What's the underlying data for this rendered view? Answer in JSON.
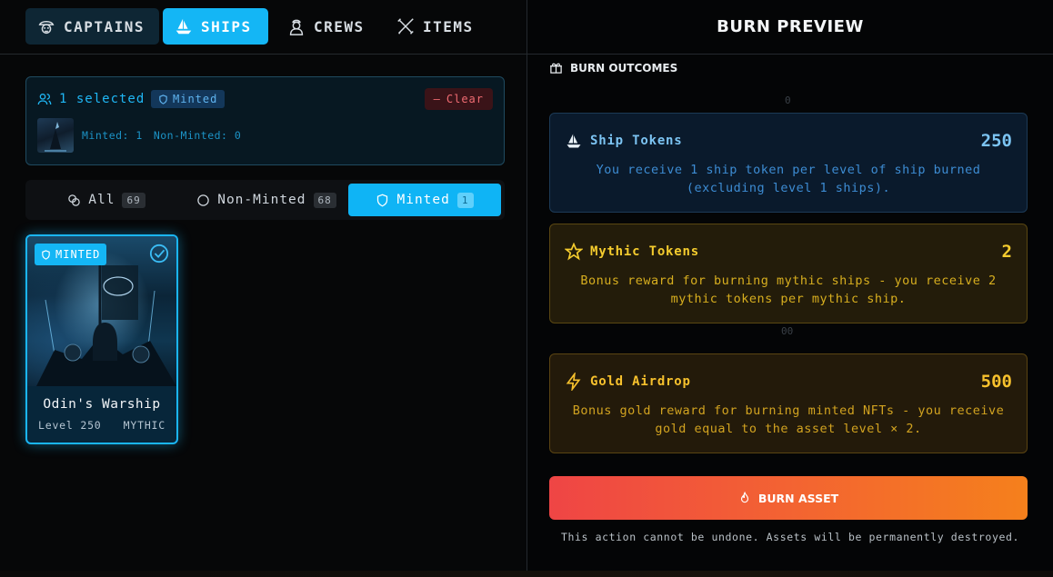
{
  "tabs": [
    {
      "label": "CAPTAINS",
      "icon": "pirate-icon"
    },
    {
      "label": "SHIPS",
      "icon": "ship-icon",
      "active": true
    },
    {
      "label": "CREWS",
      "icon": "sailor-icon"
    },
    {
      "label": "ITEMS",
      "icon": "crossed-tools-icon"
    }
  ],
  "selection": {
    "count_label": "1 selected",
    "badge": "Minted",
    "clear_label": "Clear",
    "minted_stat": "Minted: 1",
    "nonminted_stat": "Non-Minted: 0"
  },
  "filters": [
    {
      "label": "All",
      "count": "69"
    },
    {
      "label": "Non-Minted",
      "count": "68"
    },
    {
      "label": "Minted",
      "count": "1",
      "active": true
    }
  ],
  "card": {
    "badge": "MINTED",
    "title": "Odin's Warship",
    "level": "Level 250",
    "rarity": "MYTHIC"
  },
  "preview": {
    "title": "BURN PREVIEW",
    "outcomes_label": "BURN OUTCOMES",
    "stray_top": "0",
    "stray_mid": "00"
  },
  "rewards": [
    {
      "name": "Ship Tokens",
      "value": "250",
      "description": "You receive 1 ship token per level of ship burned (excluding level 1 ships)."
    },
    {
      "name": "Mythic Tokens",
      "value": "2",
      "description": "Bonus reward for burning mythic ships - you receive 2 mythic tokens per mythic ship."
    },
    {
      "name": "Gold Airdrop",
      "value": "500",
      "description": "Bonus gold reward for burning minted NFTs - you receive gold equal to the asset level × 2."
    }
  ],
  "burn": {
    "button_label": "BURN ASSET",
    "warning": "This action cannot be undone. Assets will be permanently destroyed."
  },
  "colors": {
    "accent": "#14b6f5",
    "burn_start": "#ef4545",
    "burn_end": "#f5801c",
    "gold": "#f5cc2e",
    "ship_blue": "#7cc4f3"
  }
}
